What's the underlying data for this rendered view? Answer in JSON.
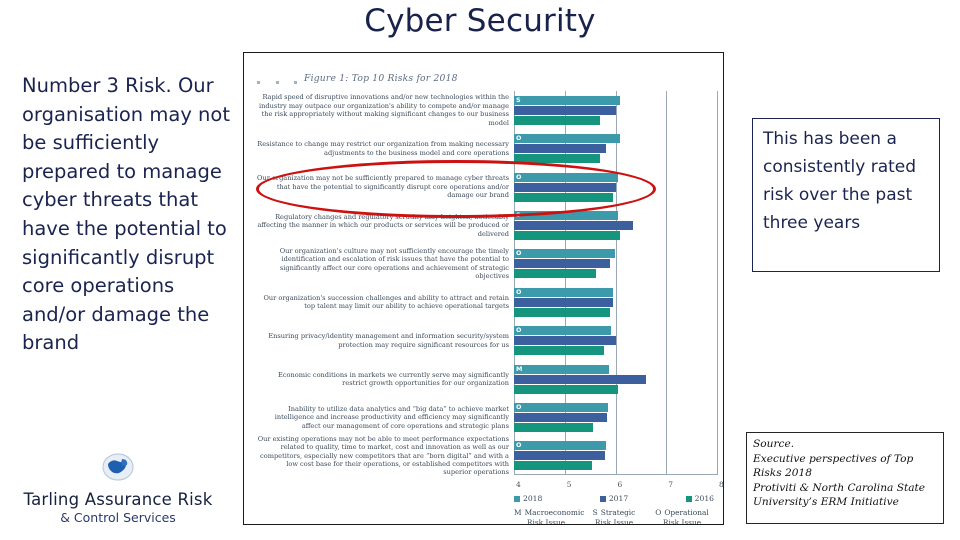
{
  "slide": {
    "title": "Cyber Security",
    "left_text": "Number 3 Risk. Our organisation may not be sufficiently prepared to manage cyber threats that have the potential to significantly disrupt core operations and/or damage the brand",
    "callout": "This has been a consistently rated risk over the past three years",
    "source": "Source. Executive perspectives of Top Risks 2018 Protiviti & North Carolina State University’s ERM Initiative",
    "source_lines": [
      "Source.",
      "Executive perspectives of Top",
      "Risks 2018",
      "Protiviti & North Carolina State",
      "University’s ERM Initiative"
    ]
  },
  "logo": {
    "icon": "globe-icon",
    "line1": "Tarling Assurance Risk",
    "line2": "& Control Services"
  },
  "figure": {
    "caption": "Figure 1: Top 10 Risks for 2018",
    "bullet_count": 3
  },
  "colors": {
    "title": "#18224a",
    "body_text": "#1b2450",
    "highlight_ellipse": "#cc1111",
    "series_2018": "#3c9aab",
    "series_2017": "#3c5f9e",
    "series_2016": "#15947e",
    "grid": "#9aa7b4"
  },
  "chart_data": {
    "type": "bar",
    "title": "Figure 1: Top 10 Risks for 2018",
    "orientation": "horizontal",
    "xlabel": "",
    "ylabel": "",
    "xlim": [
      4,
      8
    ],
    "ticks": [
      "4",
      "5",
      "6",
      "7",
      "8"
    ],
    "grid": true,
    "legend_position": "bottom",
    "series": [
      {
        "name": "2018",
        "color": "#3c9aab",
        "values": [
          6.08,
          6.08,
          6.05,
          6.04,
          5.99,
          5.95,
          5.92,
          5.88,
          5.86,
          5.82
        ]
      },
      {
        "name": "2017",
        "color": "#3c5f9e",
        "values": [
          6.0,
          5.81,
          6.0,
          6.35,
          5.9,
          5.96,
          6.0,
          6.6,
          5.83,
          5.79
        ]
      },
      {
        "name": "2016",
        "color": "#15947e",
        "values": [
          5.7,
          5.7,
          5.96,
          6.09,
          5.62,
          5.89,
          5.78,
          6.05,
          5.55,
          5.54
        ]
      }
    ],
    "categories": [
      {
        "code": "S",
        "label": "Rapid speed of disruptive innovations and/or new technologies within the industry may outpace our organization's ability to compete and/or manage the risk appropriately without making significant changes to our business model"
      },
      {
        "code": "O",
        "label": "Resistance to change may restrict our organization from making necessary adjustments to the business model and core operations"
      },
      {
        "code": "O",
        "label": "Our organization may not be sufficiently prepared to manage cyber threats that have the potential to significantly disrupt core operations and/or damage our brand"
      },
      {
        "code": "S",
        "label": "Regulatory changes and regulatory scrutiny may heighten, noticeably affecting the manner in which our products or services will be produced or delivered"
      },
      {
        "code": "O",
        "label": "Our organization's culture may not sufficiently encourage the timely identification and escalation of risk issues that have the potential to significantly affect our core operations and achievement of strategic objectives"
      },
      {
        "code": "O",
        "label": "Our organization's succession challenges and ability to attract and retain top talent may limit our ability to achieve operational targets"
      },
      {
        "code": "O",
        "label": "Ensuring privacy/identity management and information security/system protection may require significant resources for us"
      },
      {
        "code": "M",
        "label": "Economic conditions in markets we currently serve may significantly restrict growth opportunities for our organization"
      },
      {
        "code": "O",
        "label": "Inability to utilize data analytics and “big data” to achieve market intelligence and increase productivity and efficiency may significantly affect our management of core operations and strategic plans"
      },
      {
        "code": "O",
        "label": "Our existing operations may not be able to meet performance expectations related to quality, time to market, cost and innovation as well as our competitors, especially new competitors that are “born digital” and with a low cost base for their operations, or established competitors with superior operations"
      }
    ],
    "category_key": [
      {
        "letter": "M",
        "line1": "Macroeconomic",
        "line2": "Risk Issue"
      },
      {
        "letter": "S",
        "line1": "Strategic",
        "line2": "Risk Issue"
      },
      {
        "letter": "O",
        "line1": "Operational",
        "line2": "Risk Issue"
      }
    ]
  }
}
